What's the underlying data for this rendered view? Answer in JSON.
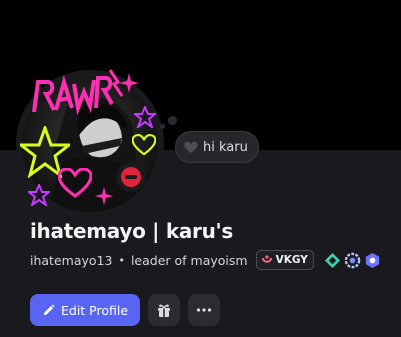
{
  "profile": {
    "display_name": "ihatemayo | karu's",
    "username": "ihatemayo13",
    "separator": "•",
    "pronouns": "leader of mayoism",
    "status_text": "hi karu",
    "guild_tag": "VKGY",
    "avatar_text": "RAWR!",
    "badges": [
      "guild-tag-badge",
      "hypesquad-balance-badge",
      "nitro-badge",
      "quest-badge"
    ]
  },
  "actions": {
    "edit_profile_label": "Edit Profile",
    "icons": [
      "pencil-icon",
      "gift-icon",
      "more-icon"
    ]
  },
  "colors": {
    "banner": "#000000",
    "background": "#1a1a1e",
    "primary_button": "#5865f2",
    "status_dnd": "#e0243c",
    "avatar_pink": "#ff2fb3",
    "avatar_yellow": "#d6ff1e"
  }
}
